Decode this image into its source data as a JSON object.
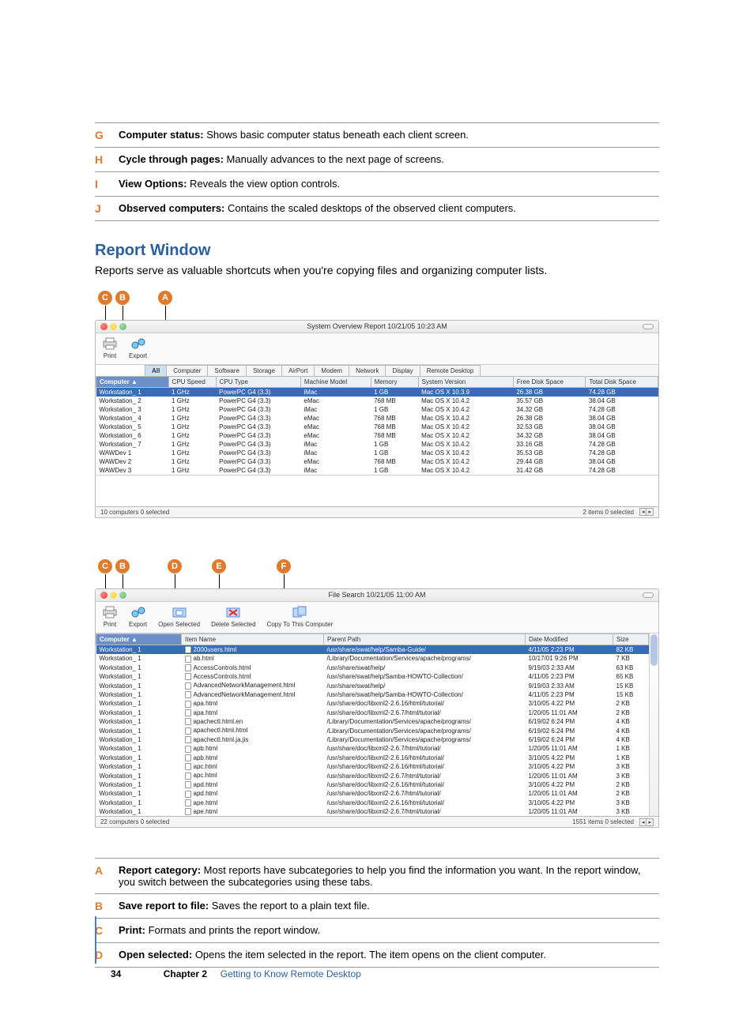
{
  "top_legend": [
    {
      "letter": "G",
      "bold": "Computer status:",
      "text": " Shows basic computer status beneath each client screen."
    },
    {
      "letter": "H",
      "bold": "Cycle through pages:",
      "text": " Manually advances to the next page of screens."
    },
    {
      "letter": "I",
      "bold": "View Options:",
      "text": " Reveals the view option controls."
    },
    {
      "letter": "J",
      "bold": "Observed computers:",
      "text": " Contains the scaled desktops of the observed client computers."
    }
  ],
  "heading": "Report Window",
  "intro": "Reports serve as valuable shortcuts when you're copying files and organizing computer lists.",
  "callouts1": [
    "C",
    "B",
    "A"
  ],
  "callouts2": [
    "C",
    "B",
    "D",
    "E",
    "F"
  ],
  "window1": {
    "title": "System Overview Report  10/21/05 10:23 AM",
    "toolbar": [
      "Print",
      "Export"
    ],
    "tabs": [
      "All",
      "Computer",
      "Software",
      "Storage",
      "AirPort",
      "Modem",
      "Network",
      "Display",
      "Remote Desktop"
    ],
    "active_tab": "All",
    "columns": [
      "Computer",
      "CPU Speed",
      "CPU Type",
      "Machine Model",
      "Memory",
      "System Version",
      "Free Disk Space",
      "Total Disk Space"
    ],
    "sorted_col": "Computer",
    "rows": [
      [
        "Workstation_ 1",
        "1 GHz",
        "PowerPC G4 (3.3)",
        "iMac",
        "1 GB",
        "Mac OS X 10.3.9",
        "26.38 GB",
        "74.28 GB"
      ],
      [
        "Workstation_ 2",
        "1 GHz",
        "PowerPC G4 (3.3)",
        "eMac",
        "768 MB",
        "Mac OS X 10.4.2",
        "35.57 GB",
        "38.04 GB"
      ],
      [
        "Workstation_ 3",
        "1 GHz",
        "PowerPC G4 (3.3)",
        "iMac",
        "1 GB",
        "Mac OS X 10.4.2",
        "34.32 GB",
        "74.28 GB"
      ],
      [
        "Workstation_ 4",
        "1 GHz",
        "PowerPC G4 (3.3)",
        "eMac",
        "768 MB",
        "Mac OS X 10.4.2",
        "26.38 GB",
        "38.04 GB"
      ],
      [
        "Workstation_ 5",
        "1 GHz",
        "PowerPC G4 (3.3)",
        "eMac",
        "768 MB",
        "Mac OS X 10.4.2",
        "32.53 GB",
        "38.04 GB"
      ],
      [
        "Workstation_ 6",
        "1 GHz",
        "PowerPC G4 (3.3)",
        "eMac",
        "768 MB",
        "Mac OS X 10.4.2",
        "34.32 GB",
        "38.04 GB"
      ],
      [
        "Workstation_ 7",
        "1 GHz",
        "PowerPC G4 (3.3)",
        "iMac",
        "1 GB",
        "Mac OS X 10.4.2",
        "33.16 GB",
        "74.28 GB"
      ],
      [
        "WAWDev 1",
        "1 GHz",
        "PowerPC G4 (3.3)",
        "iMac",
        "1 GB",
        "Mac OS X 10.4.2",
        "35.53 GB",
        "74.28 GB"
      ],
      [
        "WAWDev 2",
        "1 GHz",
        "PowerPC G4 (3.3)",
        "eMac",
        "768 MB",
        "Mac OS X 10.4.2",
        "29.44 GB",
        "38.04 GB"
      ],
      [
        "WAWDev 3",
        "1 GHz",
        "PowerPC G4 (3.3)",
        "iMac",
        "1 GB",
        "Mac OS X 10.4.2",
        "31.42 GB",
        "74.28 GB"
      ]
    ],
    "status_left": "10 computers   0 selected",
    "status_right": "2 items   0 selected"
  },
  "window2": {
    "title": "File Search  10/21/05 11:00 AM",
    "toolbar": [
      "Print",
      "Export",
      "Open Selected",
      "Delete Selected",
      "Copy To This Computer"
    ],
    "columns": [
      "Computer",
      "Item Name",
      "Parent Path",
      "Date Modified",
      "Size"
    ],
    "sorted_col": "Computer",
    "rows": [
      [
        "Workstation_ 1",
        "2000users.html",
        "/usr/share/swat/help/Samba-Guide/",
        "4/11/05 2:23 PM",
        "82 KB"
      ],
      [
        "Workstation_ 1",
        "ab.html",
        "/Library/Documentation/Services/apache/programs/",
        "10/17/01 9:26 PM",
        "7 KB"
      ],
      [
        "Workstation_ 1",
        "AccessControls.html",
        "/usr/share/swat/help/",
        "9/19/03 2:33 AM",
        "63 KB"
      ],
      [
        "Workstation_ 1",
        "AccessControls.html",
        "/usr/share/swat/help/Samba-HOWTO-Collection/",
        "4/11/05 2:23 PM",
        "65 KB"
      ],
      [
        "Workstation_ 1",
        "AdvancedNetworkManagement.html",
        "/usr/share/swat/help/",
        "9/19/03 2:33 AM",
        "15 KB"
      ],
      [
        "Workstation_ 1",
        "AdvancedNetworkManagement.html",
        "/usr/share/swat/help/Samba-HOWTO-Collection/",
        "4/11/05 2:23 PM",
        "15 KB"
      ],
      [
        "Workstation_ 1",
        "apa.html",
        "/usr/share/doc/libxml2-2.6.16/html/tutorial/",
        "3/10/05 4:22 PM",
        "2 KB"
      ],
      [
        "Workstation_ 1",
        "apa.html",
        "/usr/share/doc/libxml2-2.6.7/html/tutorial/",
        "1/20/05 11:01 AM",
        "2 KB"
      ],
      [
        "Workstation_ 1",
        "apachectl.html.en",
        "/Library/Documentation/Services/apache/programs/",
        "6/19/02 6:24 PM",
        "4 KB"
      ],
      [
        "Workstation_ 1",
        "apachectl.html.html",
        "/Library/Documentation/Services/apache/programs/",
        "6/19/02 6:24 PM",
        "4 KB"
      ],
      [
        "Workstation_ 1",
        "apachectl.html.ja.jis",
        "/Library/Documentation/Services/apache/programs/",
        "6/19/02 6:24 PM",
        "4 KB"
      ],
      [
        "Workstation_ 1",
        "apb.html",
        "/usr/share/doc/libxml2-2.6.7/html/tutorial/",
        "1/20/05 11:01 AM",
        "1 KB"
      ],
      [
        "Workstation_ 1",
        "apb.html",
        "/usr/share/doc/libxml2-2.6.16/html/tutorial/",
        "3/10/05 4:22 PM",
        "1 KB"
      ],
      [
        "Workstation_ 1",
        "apc.html",
        "/usr/share/doc/libxml2-2.6.16/html/tutorial/",
        "3/10/05 4:22 PM",
        "3 KB"
      ],
      [
        "Workstation_ 1",
        "apc.html",
        "/usr/share/doc/libxml2-2.6.7/html/tutorial/",
        "1/20/05 11:01 AM",
        "3 KB"
      ],
      [
        "Workstation_ 1",
        "apd.html",
        "/usr/share/doc/libxml2-2.6.16/html/tutorial/",
        "3/10/05 4:22 PM",
        "2 KB"
      ],
      [
        "Workstation_ 1",
        "apd.html",
        "/usr/share/doc/libxml2-2.6.7/html/tutorial/",
        "1/20/05 11:01 AM",
        "2 KB"
      ],
      [
        "Workstation_ 1",
        "ape.html",
        "/usr/share/doc/libxml2-2.6.16/html/tutorial/",
        "3/10/05 4:22 PM",
        "3 KB"
      ],
      [
        "Workstation_ 1",
        "ape.html",
        "/usr/share/doc/libxml2-2.6.7/html/tutorial/",
        "1/20/05 11:01 AM",
        "3 KB"
      ]
    ],
    "status_left": "22 computers   0 selected",
    "status_right": "1551 items   0 selected"
  },
  "bottom_legend": [
    {
      "letter": "A",
      "bold": "Report category:",
      "text": " Most reports have subcategories to help you find the information you want. In the report window, you switch between the subcategories using these tabs."
    },
    {
      "letter": "B",
      "bold": "Save report to file:",
      "text": " Saves the report to a plain text file."
    },
    {
      "letter": "C",
      "bold": "Print:",
      "text": " Formats and prints the report window."
    },
    {
      "letter": "D",
      "bold": "Open selected:",
      "text": " Opens the item selected in the report. The item opens on the client computer."
    }
  ],
  "footer": {
    "page": "34",
    "chapter": "Chapter 2",
    "title": "Getting to Know Remote Desktop"
  },
  "icons": {
    "print": "printer-icon",
    "export": "export-icon",
    "open": "open-icon",
    "delete": "delete-icon",
    "copy": "copy-icon"
  }
}
